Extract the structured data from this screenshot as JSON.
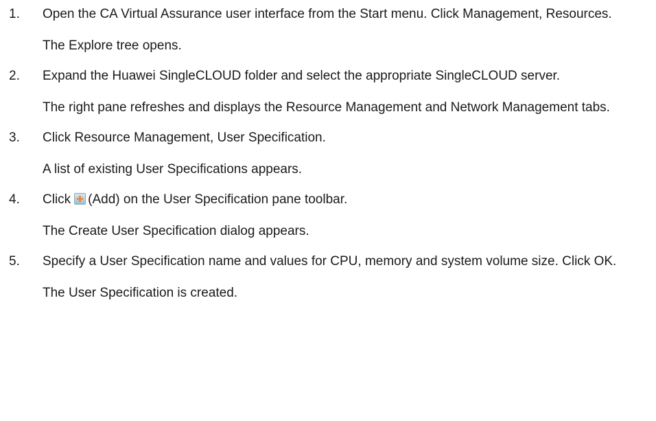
{
  "steps": [
    {
      "number": "1.",
      "instruction": "Open the CA Virtual Assurance user interface from the Start menu. Click Management, Resources.",
      "result": "The Explore tree opens."
    },
    {
      "number": "2.",
      "instruction": "Expand the Huawei SingleCLOUD folder and select the appropriate SingleCLOUD server.",
      "result": "The right pane refreshes and displays the Resource Management and Network Management tabs."
    },
    {
      "number": "3.",
      "instruction": "Click Resource Management, User Specification.",
      "result": "A list of existing User Specifications appears."
    },
    {
      "number": "4.",
      "instruction_before_icon": "Click",
      "icon": "add-icon",
      "instruction_after_icon": "(Add) on the User Specification pane toolbar.",
      "result": "The Create User Specification dialog appears."
    },
    {
      "number": "5.",
      "instruction": "Specify a User Specification name and values for CPU, memory and system volume size. Click OK.",
      "result": "The User Specification is created."
    }
  ]
}
